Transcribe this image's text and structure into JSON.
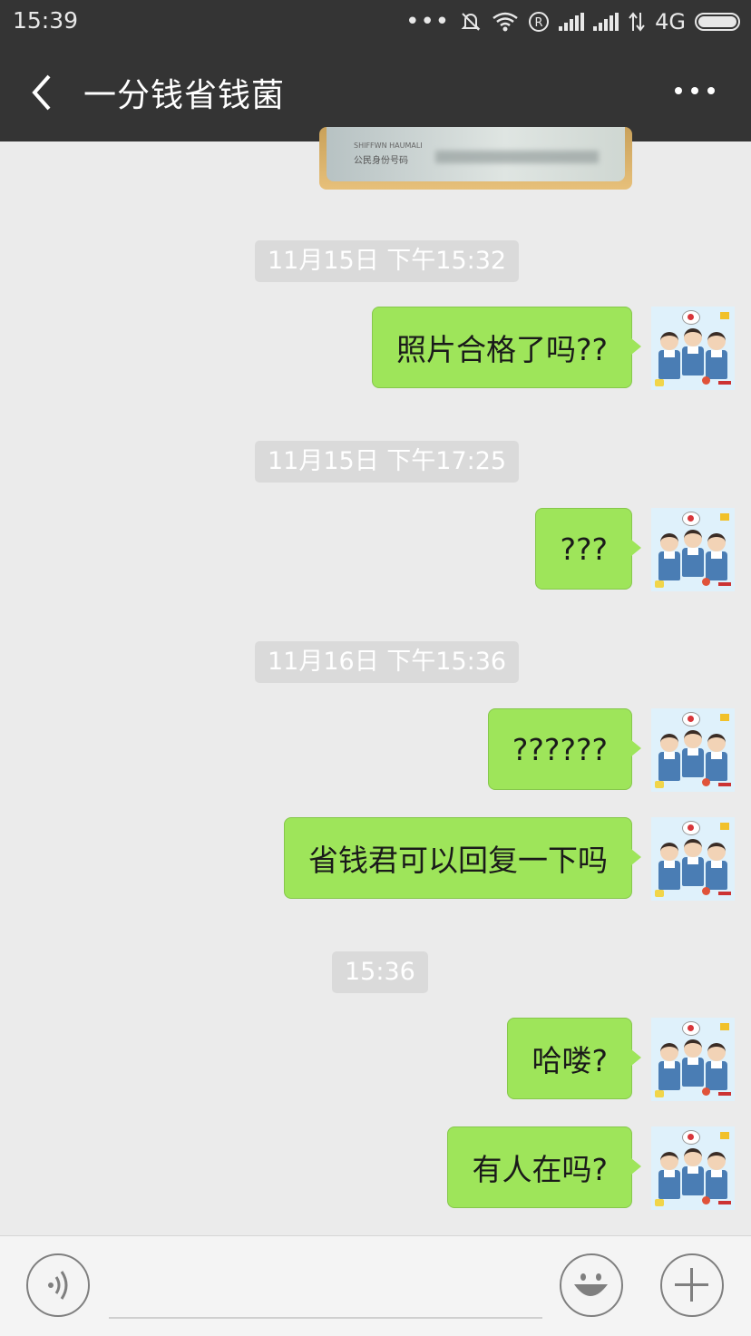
{
  "status_bar": {
    "time": "15:39",
    "network": "4G",
    "icons": [
      "more-dots-icon",
      "mute-bell-icon",
      "wifi-icon",
      "registered-icon",
      "signal-icon",
      "signal-icon",
      "data-arrows-icon",
      "battery-icon"
    ]
  },
  "header": {
    "title": "一分钱省钱菌",
    "back_icon": "chevron-left-icon",
    "more_icon": "more-horizontal-icon"
  },
  "messages": [
    {
      "type": "image",
      "side": "right",
      "content": "ID card photo",
      "card_text_1": "SHIFFWN HAUMALI",
      "card_text_2": "公民身份号码"
    },
    {
      "type": "timestamp",
      "text": "11月15日 下午15:32"
    },
    {
      "type": "text",
      "side": "right",
      "text": "照片合格了吗??"
    },
    {
      "type": "timestamp",
      "text": "11月15日 下午17:25"
    },
    {
      "type": "text",
      "side": "right",
      "text": "???"
    },
    {
      "type": "timestamp",
      "text": "11月16日 下午15:36"
    },
    {
      "type": "text",
      "side": "right",
      "text": "??????"
    },
    {
      "type": "text",
      "side": "right",
      "text": "省钱君可以回复一下吗"
    },
    {
      "type": "timestamp",
      "text": "15:36"
    },
    {
      "type": "text",
      "side": "right",
      "text": "哈喽?"
    },
    {
      "type": "text",
      "side": "right",
      "text": "有人在吗?"
    }
  ],
  "input_bar": {
    "voice_icon": "voice-icon",
    "emoji_icon": "emoji-icon",
    "plus_icon": "plus-icon",
    "text_value": ""
  },
  "colors": {
    "header_bg": "#343434",
    "chat_bg": "#ebebeb",
    "bubble_green": "#9ee55a",
    "timestamp_bg": "#dadada"
  }
}
